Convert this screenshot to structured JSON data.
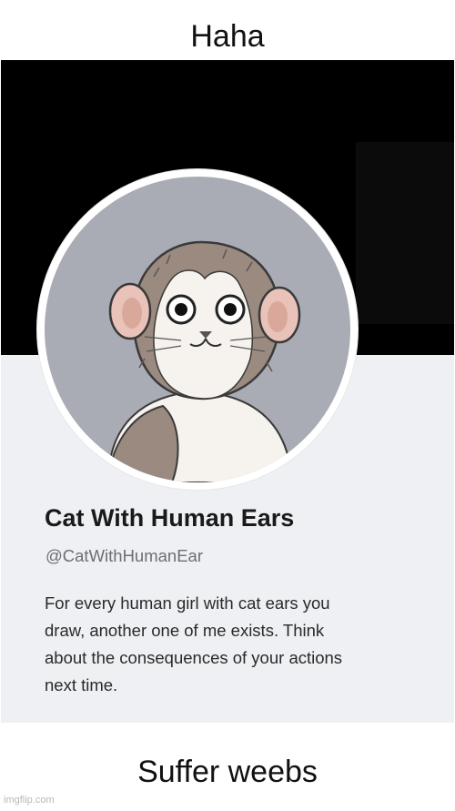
{
  "meme": {
    "top_caption": "Haha",
    "bottom_caption": "Suffer weebs",
    "watermark": "imgflip.com"
  },
  "profile": {
    "name": "Cat With Human Ears",
    "handle": "@CatWithHumanEar",
    "bio_lines": [
      "For every human girl with cat ears you",
      "draw, another one of me exists. Think",
      "about the consequences of your actions",
      "next time."
    ],
    "avatar_icon": "cat-with-human-ears-avatar",
    "colors": {
      "banner": "#000000",
      "card_background": "#eef0f3",
      "avatar_background": "#a9acb4",
      "fur_brown": "#9a8a80",
      "fur_white": "#f6f3ee",
      "ear_pink": "#e9c3b9"
    }
  }
}
